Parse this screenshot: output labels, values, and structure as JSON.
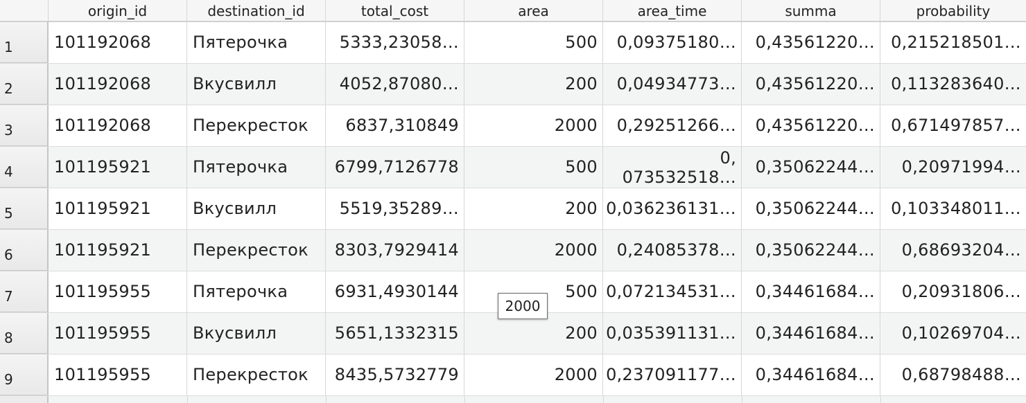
{
  "columns": [
    "origin_id",
    "destination_id",
    "total_cost",
    "area",
    "area_time",
    "summa",
    "probability"
  ],
  "rows": [
    {
      "num": "1",
      "origin_id": "101192068",
      "destination_id": "Пятерочка",
      "total_cost": "5333,23058…",
      "area": "500",
      "area_time": "0,09375180…",
      "summa": "0,43561220…",
      "probability": "0,215218501…"
    },
    {
      "num": "2",
      "origin_id": "101192068",
      "destination_id": "Вкусвилл",
      "total_cost": "4052,87080…",
      "area": "200",
      "area_time": "0,04934773…",
      "summa": "0,43561220…",
      "probability": "0,113283640…"
    },
    {
      "num": "3",
      "origin_id": "101192068",
      "destination_id": "Перекресток",
      "total_cost": "6837,310849",
      "area": "2000",
      "area_time": "0,29251266…",
      "summa": "0,43561220…",
      "probability": "0,671497857…"
    },
    {
      "num": "4",
      "origin_id": "101195921",
      "destination_id": "Пятерочка",
      "total_cost": "6799,7126778",
      "area": "500",
      "area_time_line1": "0,",
      "area_time_line2": "073532518…",
      "summa": "0,35062244…",
      "probability": "0,20971994…"
    },
    {
      "num": "5",
      "origin_id": "101195921",
      "destination_id": "Вкусвилл",
      "total_cost": "5519,35289…",
      "area": "200",
      "area_time": "0,036236131…",
      "summa": "0,35062244…",
      "probability": "0,103348011…"
    },
    {
      "num": "6",
      "origin_id": "101195921",
      "destination_id": "Перекресток",
      "total_cost": "8303,7929414",
      "area": "2000",
      "area_time": "0,24085378…",
      "summa": "0,35062244…",
      "probability": "0,68693204…"
    },
    {
      "num": "7",
      "origin_id": "101195955",
      "destination_id": "Пятерочка",
      "total_cost": "6931,4930144",
      "area": "500",
      "area_time": "0,072134531…",
      "summa": "0,34461684…",
      "probability": "0,20931806…"
    },
    {
      "num": "8",
      "origin_id": "101195955",
      "destination_id": "Вкусвилл",
      "total_cost": "5651,1332315",
      "area": "200",
      "area_time": "0,035391131…",
      "summa": "0,34461684…",
      "probability": "0,10269704…"
    },
    {
      "num": "9",
      "origin_id": "101195955",
      "destination_id": "Перекресток",
      "total_cost": "8435,5732779",
      "area": "2000",
      "area_time": "0,237091177…",
      "summa": "0,34461684…",
      "probability": "0,68798488…"
    }
  ],
  "tooltip": "2000"
}
